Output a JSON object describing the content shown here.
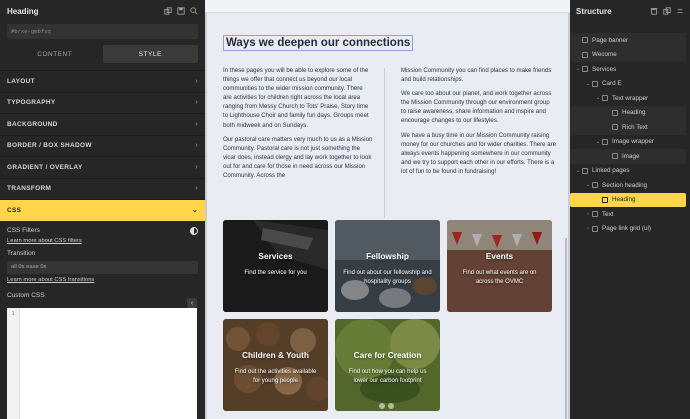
{
  "left_panel": {
    "title": "Heading",
    "element_id": "#brxe-gmbfsq",
    "tabs": [
      "CONTENT",
      "STYLE"
    ],
    "sections": [
      "LAYOUT",
      "TYPOGRAPHY",
      "BACKGROUND",
      "BORDER / BOX SHADOW",
      "GRADIENT / OVERLAY",
      "TRANSFORM",
      "CSS"
    ],
    "css": {
      "filters_label": "CSS Filters",
      "filters_link": "Learn more about CSS filters",
      "transition_label": "Transition",
      "transition_placeholder": "all 0s ease 0s",
      "transitions_link": "Learn more about CSS transitions",
      "custom_css_label": "Custom CSS",
      "line_number": "1"
    }
  },
  "canvas": {
    "heading": "Ways we deepen our connections",
    "col1": [
      "In these pages you will be able to explore some of the things we offer that connect us beyond our local communities to the wider mission community. There are activities for children right across the local area ranging from Messy Church to Tots' Praise, Story time to Lighthouse Choir and family fun days. Groups meet both midweek and on Sundays.",
      "Our pastoral care matters very much to us as a Mission Community. Pastoral care is not just something the vicar does, instead clergy and lay work together to look out for and care for those in need across our Mission Community. Across the"
    ],
    "col2": [
      "Mission Community you can find places to make friends and build relationships.",
      "We care too about our planet, and work together across the Mission Community through our environment group to raise awareness, share information and inspire and encourage changes to our lifestyles.",
      "We have a busy time in our Mission Community raising money for our churches and for wider charities. There are always events happening somewhere in our community and we try to support each other in our efforts. There is a lot of fun to be found in fundraising!"
    ],
    "cards": [
      {
        "title": "Services",
        "desc": "Find the service for you"
      },
      {
        "title": "Fellowship",
        "desc": "Find out about our fellowship and hospitality groups"
      },
      {
        "title": "Events",
        "desc": "Find out what events are on across the OVMC"
      },
      {
        "title": "Children & Youth",
        "desc": "Find out the activities available for young people"
      },
      {
        "title": "Care for Creation",
        "desc": "Find out how you can help us lower our carbon footprint"
      }
    ]
  },
  "structure": {
    "title": "Structure",
    "nodes": [
      {
        "label": "Page banner",
        "depth": 0
      },
      {
        "label": "Wecome",
        "depth": 0
      },
      {
        "label": "Services",
        "depth": 0
      },
      {
        "label": "Card E",
        "depth": 1
      },
      {
        "label": "Text wrapper",
        "depth": 2
      },
      {
        "label": "Heading",
        "depth": 3
      },
      {
        "label": "Rich Text",
        "depth": 3
      },
      {
        "label": "Image wrapper",
        "depth": 2
      },
      {
        "label": "Image",
        "depth": 3
      },
      {
        "label": "Linked pages",
        "depth": 0
      },
      {
        "label": "Section heading",
        "depth": 1
      },
      {
        "label": "Heading",
        "depth": 2
      },
      {
        "label": "Text",
        "depth": 1
      },
      {
        "label": "Page link grid (ul)",
        "depth": 1
      }
    ]
  },
  "colors": {
    "accent": "#ffd54a",
    "panel": "#262626",
    "canvas": "#e9ecf2"
  }
}
